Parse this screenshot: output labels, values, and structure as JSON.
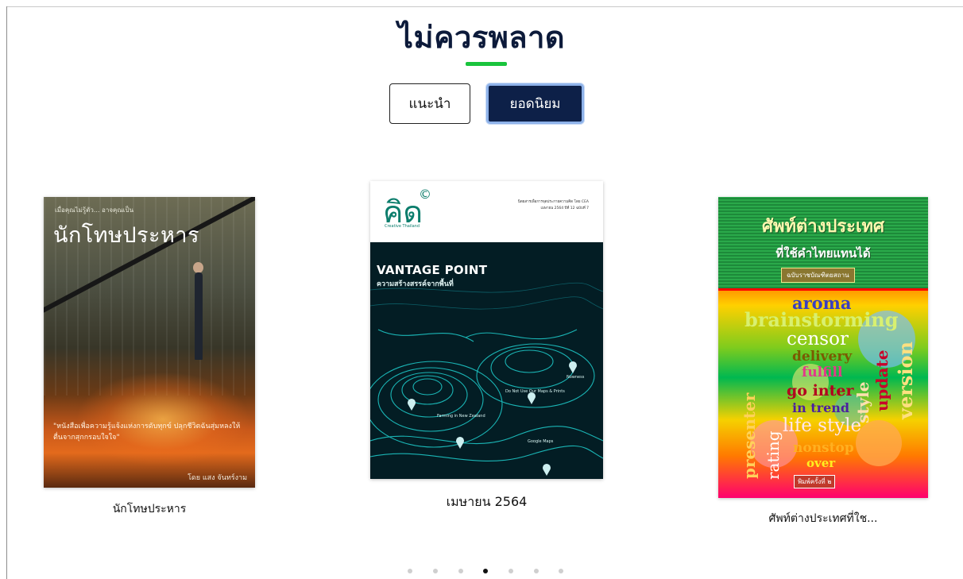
{
  "section": {
    "title": "ไม่ควรพลาด"
  },
  "tabs": [
    {
      "label": "แนะนำ",
      "active": false
    },
    {
      "label": "ยอดนิยม",
      "active": true
    }
  ],
  "books": [
    {
      "caption": "นักโทษประหาร",
      "cover": {
        "kicker": "เมื่อคุณไม่รู้ตัว... อาจคุณเป็น",
        "title": "นักโทษประหาร",
        "quote": "\"หนังสือเพื่อความรู้แจ้งแห่งการดับทุกข์ ปลุกชีวิตฉันสุ่มหลงให้ตื่นจากสุกกรอบใจใจ\"",
        "author": "โดย แสง จันทร์งาม"
      }
    },
    {
      "caption": "เมษายน 2564",
      "cover": {
        "logo": "คิด",
        "copyright": "©",
        "subbrand": "Creative Thailand",
        "info_line1": "นิตยสารเพื่อการจุดประกายความคิด โดย CEA",
        "info_line2": "เมษายน 2564 ปีที่ 12 ฉบับที่ 7",
        "headline": "VANTAGE POINT",
        "subheadline": "ความสร้างสรรค์จากพื้นที่",
        "map_labels": [
          "Nowness",
          "Do Not Use Our Maps & Prints",
          "Farming in New Zealand",
          "Google Maps"
        ]
      }
    },
    {
      "caption": "ศัพท์ต่างประเทศที่ใช...",
      "cover": {
        "title": "ศัพท์ต่างประเทศ",
        "subtitle": "ที่ใช้คำไทยแทนได้",
        "edition": "ฉบับราชบัณฑิตยสถาน",
        "words": [
          "aroma",
          "brainstorming",
          "censor",
          "delivery",
          "fulfill",
          "go inter",
          "in trend",
          "life style",
          "nonstop",
          "over",
          "presenter",
          "rating",
          "style",
          "update",
          "version"
        ],
        "print_note": "พิมพ์ครั้งที่ ๒"
      }
    }
  ],
  "carousel": {
    "dot_count": 7,
    "active_index": 3
  },
  "colors": {
    "accent": "#19c43c",
    "primary": "#0d2048",
    "title": "#0c1a3a"
  }
}
